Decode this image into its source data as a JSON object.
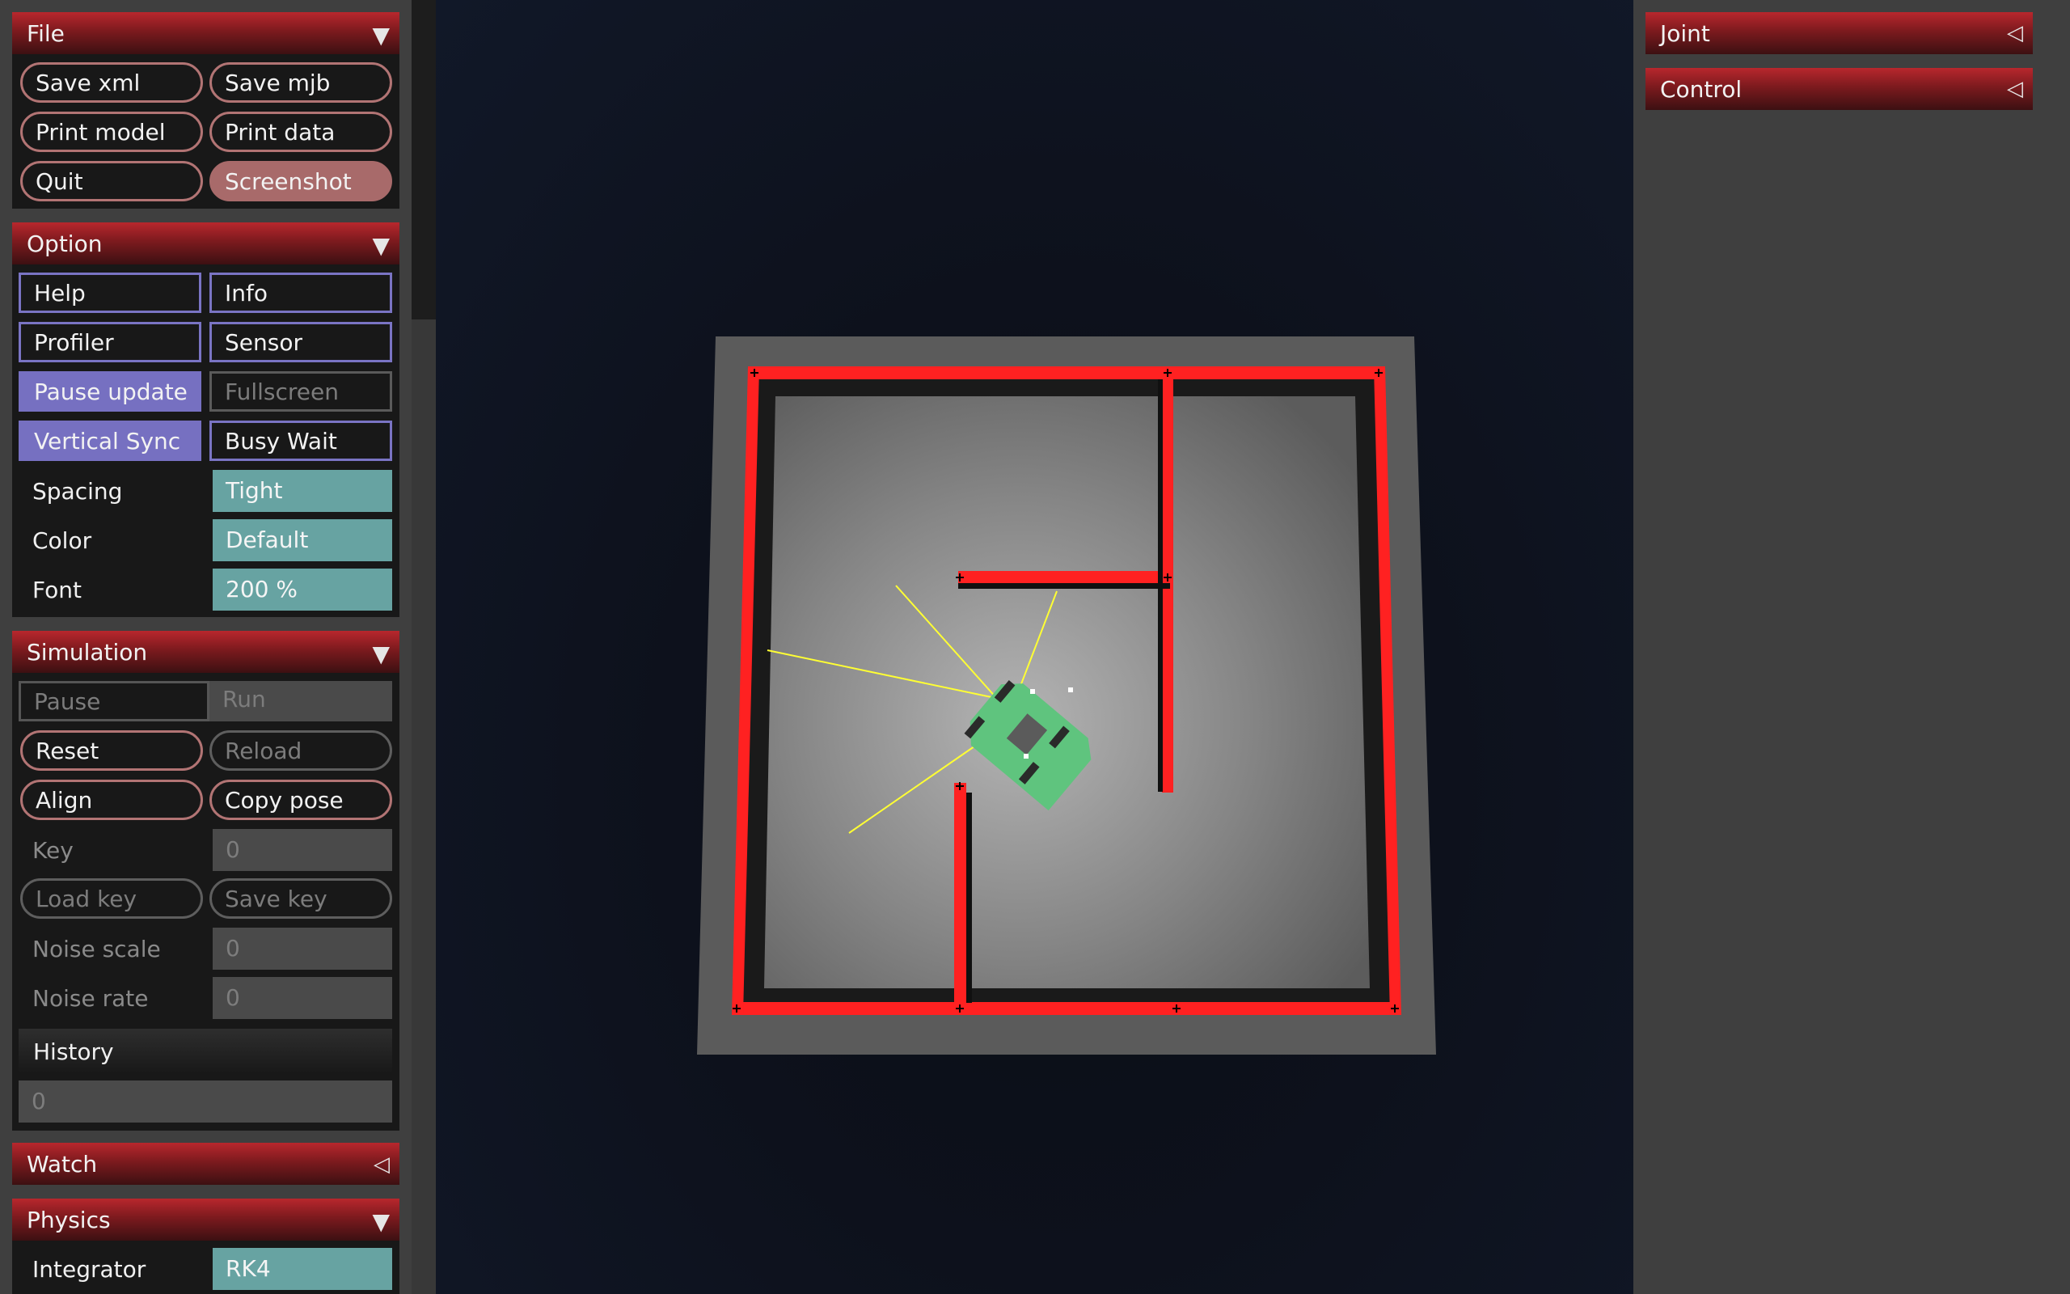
{
  "file": {
    "title": "File",
    "save_xml": "Save xml",
    "save_mjb": "Save mjb",
    "print_model": "Print model",
    "print_data": "Print data",
    "quit": "Quit",
    "screenshot": "Screenshot"
  },
  "option": {
    "title": "Option",
    "help": "Help",
    "info": "Info",
    "profiler": "Profiler",
    "sensor": "Sensor",
    "pause_update": "Pause update",
    "fullscreen": "Fullscreen",
    "vertical_sync": "Vertical Sync",
    "busy_wait": "Busy Wait",
    "spacing_label": "Spacing",
    "spacing_value": "Tight",
    "color_label": "Color",
    "color_value": "Default",
    "font_label": "Font",
    "font_value": "200 %"
  },
  "simulation": {
    "title": "Simulation",
    "pause": "Pause",
    "run": "Run",
    "reset": "Reset",
    "reload": "Reload",
    "align": "Align",
    "copy_pose": "Copy pose",
    "key_label": "Key",
    "key_value": "0",
    "load_key": "Load key",
    "save_key": "Save key",
    "noise_scale_label": "Noise scale",
    "noise_scale_value": "0",
    "noise_rate_label": "Noise rate",
    "noise_rate_value": "0",
    "history_label": "History",
    "history_value": "0"
  },
  "watch": {
    "title": "Watch"
  },
  "physics": {
    "title": "Physics",
    "integrator_label": "Integrator",
    "integrator_value": "RK4"
  },
  "right_panel": {
    "joint": "Joint",
    "control": "Control"
  },
  "icons": {
    "expanded": "triangle-down-icon",
    "collapsed": "triangle-left-icon"
  },
  "colors": {
    "header_red": "#b8272d",
    "toggle_blue": "#7670c1",
    "select_teal": "#67a3a2",
    "button_border": "#b27474",
    "wall_red": "#ff2020",
    "robot_green": "#5fc47e",
    "sensor_ray": "#ffff33"
  }
}
